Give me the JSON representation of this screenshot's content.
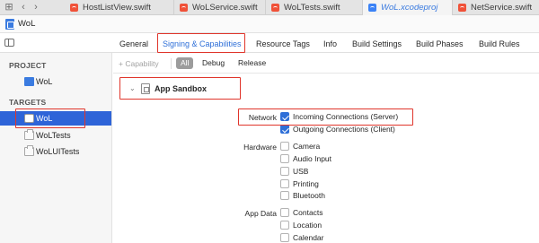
{
  "file_tabs": [
    {
      "label": "HostListView.swift",
      "active": false
    },
    {
      "label": "WoLService.swift",
      "active": false
    },
    {
      "label": "WoLTests.swift",
      "active": false
    },
    {
      "label": "WoL.xcodeproj",
      "active": true
    },
    {
      "label": "NetService.swift",
      "active": false
    }
  ],
  "project_header": {
    "name": "WoL"
  },
  "editor_tabs": [
    {
      "label": "General"
    },
    {
      "label": "Signing & Capabilities"
    },
    {
      "label": "Resource Tags"
    },
    {
      "label": "Info"
    },
    {
      "label": "Build Settings"
    },
    {
      "label": "Build Phases"
    },
    {
      "label": "Build Rules"
    }
  ],
  "sidebar": {
    "project_header": "PROJECT",
    "project_item": "WoL",
    "targets_header": "TARGETS",
    "targets": [
      {
        "label": "WoL",
        "selected": true
      },
      {
        "label": "WoLTests",
        "selected": false
      },
      {
        "label": "WoLUITests",
        "selected": false
      }
    ]
  },
  "capability_bar": {
    "add_label": "+ Capability",
    "filters": [
      {
        "label": "All",
        "active": true
      },
      {
        "label": "Debug",
        "active": false
      },
      {
        "label": "Release",
        "active": false
      }
    ]
  },
  "sandbox": {
    "title": "App Sandbox",
    "groups": {
      "network": "Network",
      "hardware": "Hardware",
      "app_data": "App Data"
    },
    "options": {
      "incoming": {
        "label": "Incoming Connections (Server)",
        "checked": true
      },
      "outgoing": {
        "label": "Outgoing Connections (Client)",
        "checked": true
      },
      "camera": {
        "label": "Camera",
        "checked": false
      },
      "audio": {
        "label": "Audio Input",
        "checked": false
      },
      "usb": {
        "label": "USB",
        "checked": false
      },
      "printing": {
        "label": "Printing",
        "checked": false
      },
      "bluetooth": {
        "label": "Bluetooth",
        "checked": false
      },
      "contacts": {
        "label": "Contacts",
        "checked": false
      },
      "location": {
        "label": "Location",
        "checked": false
      },
      "calendar": {
        "label": "Calendar",
        "checked": false
      }
    }
  },
  "colors": {
    "accent": "#2e6fd8",
    "highlight": "#e0352b",
    "selection": "#2e64d8"
  }
}
